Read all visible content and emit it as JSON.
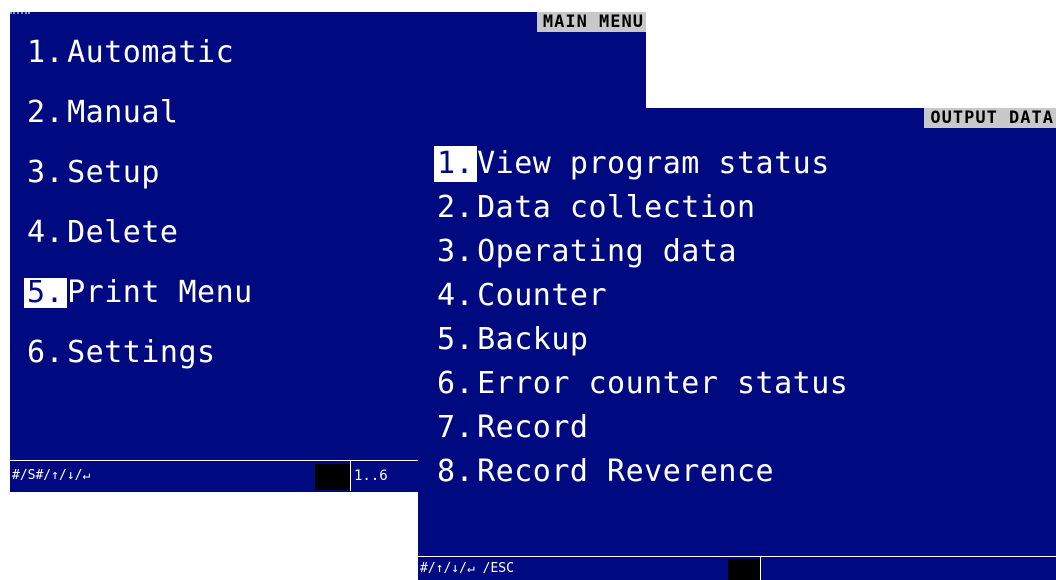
{
  "main_menu": {
    "title": "MAIN MENU",
    "items": [
      {
        "number": "1.",
        "label": "Automatic",
        "selected": false
      },
      {
        "number": "2.",
        "label": "Manual",
        "selected": false
      },
      {
        "number": "3.",
        "label": "Setup",
        "selected": false
      },
      {
        "number": "4.",
        "label": "Delete",
        "selected": false
      },
      {
        "number": "5.",
        "label": "Print Menu",
        "selected": true
      },
      {
        "number": "6.",
        "label": "Settings",
        "selected": false
      }
    ],
    "status_keys": "#/S#/↑/↓/↵",
    "status_range": "1..6"
  },
  "output_data": {
    "title": "OUTPUT DATA",
    "items": [
      {
        "number": "1.",
        "label": "View program status",
        "selected": true
      },
      {
        "number": "2.",
        "label": "Data collection",
        "selected": false
      },
      {
        "number": "3.",
        "label": "Operating data",
        "selected": false
      },
      {
        "number": "4.",
        "label": "Counter",
        "selected": false
      },
      {
        "number": "5.",
        "label": "Backup",
        "selected": false
      },
      {
        "number": "6.",
        "label": "Error counter status",
        "selected": false
      },
      {
        "number": "7.",
        "label": "Record",
        "selected": false
      },
      {
        "number": "8.",
        "label": "Record Reverence",
        "selected": false
      }
    ],
    "status_keys": "#/↑/↓/↵ /ESC"
  },
  "colors": {
    "panel_background": "#000a80",
    "text": "#ffffff",
    "title_tag_background": "#c8c8c8",
    "status_box": "#000000"
  }
}
